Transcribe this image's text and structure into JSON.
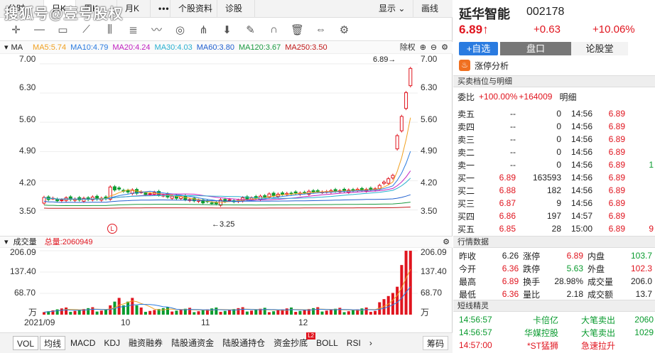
{
  "watermark": "搜狐号@壹号股权",
  "tabs": [
    "分时",
    "日K",
    "周K",
    "月K",
    "•••",
    "个股资料",
    "诊股"
  ],
  "tabs_right": {
    "display": "显示",
    "draw": "画线"
  },
  "toolbar_icons": [
    "crosshair-icon",
    "line-icon",
    "rect-icon",
    "fan-icon",
    "gann-icon",
    "fib-icon",
    "wave-icon",
    "cycle-icon",
    "pitchfork-icon",
    "arrow-down-icon",
    "eraser-icon",
    "magnet-icon",
    "trash-icon",
    "expand-icon",
    "settings-icon"
  ],
  "ma_bar": {
    "label": "MA",
    "items": [
      {
        "text": "MA5:5.74",
        "color": "#f0a020"
      },
      {
        "text": "MA10:4.79",
        "color": "#2a7be0"
      },
      {
        "text": "MA20:4.24",
        "color": "#c020c0"
      },
      {
        "text": "MA30:4.03",
        "color": "#28b0d0"
      },
      {
        "text": "MA60:3.80",
        "color": "#2060d0"
      },
      {
        "text": "MA120:3.67",
        "color": "#1a9a40"
      },
      {
        "text": "MA250:3.50",
        "color": "#c01818"
      }
    ],
    "right_label": "除权"
  },
  "price_axis": [
    "7.00",
    "6.30",
    "5.60",
    "4.90",
    "4.20",
    "3.50"
  ],
  "annotations": {
    "high": "6.89→",
    "low": "←3.25",
    "marker": "L"
  },
  "volume_bar": {
    "label": "成交量",
    "total": "总量:2060949"
  },
  "volume_axis": [
    "206.09",
    "137.40",
    "68.70",
    "万"
  ],
  "x_labels": [
    "2021/09",
    "10",
    "11",
    "12"
  ],
  "bottom_tabs": [
    "VOL",
    "均线",
    "MACD",
    "KDJ",
    "融资融券",
    "陆股通资金",
    "陆股通持仓",
    "资金抄底",
    "BOLL",
    "RSI",
    "›"
  ],
  "bottom_badge": "L2",
  "bottom_right": "筹码",
  "stock": {
    "name": "延华智能",
    "code": "002178",
    "price": "6.89",
    "arrow": "↑",
    "change": "+0.63",
    "pct": "+10.06%"
  },
  "buttons": {
    "add": "+自选",
    "panel": "盘口",
    "forum": "论股堂"
  },
  "limit_label": "涨停分析",
  "orderbook": {
    "title": "买卖档位与明细",
    "ratio_label": "委比",
    "ratio_value": "+100.00%",
    "ratio_diff": "+164009",
    "detail_label": "明细",
    "sells": [
      {
        "name": "卖五",
        "price": "--",
        "vol": "0"
      },
      {
        "name": "卖四",
        "price": "--",
        "vol": "0"
      },
      {
        "name": "卖三",
        "price": "--",
        "vol": "0"
      },
      {
        "name": "卖二",
        "price": "--",
        "vol": "0"
      },
      {
        "name": "卖一",
        "price": "--",
        "vol": "0"
      }
    ],
    "buys": [
      {
        "name": "买一",
        "price": "6.89",
        "vol": "163593"
      },
      {
        "name": "买二",
        "price": "6.88",
        "vol": "182"
      },
      {
        "name": "买三",
        "price": "6.87",
        "vol": "9"
      },
      {
        "name": "买四",
        "price": "6.86",
        "vol": "197"
      },
      {
        "name": "买五",
        "price": "6.85",
        "vol": "28"
      }
    ],
    "ticks": [
      {
        "t": "14:56",
        "p": "6.89",
        "v": "",
        "c": "red"
      },
      {
        "t": "14:56",
        "p": "6.89",
        "v": "",
        "c": "red"
      },
      {
        "t": "14:56",
        "p": "6.89",
        "v": "",
        "c": "red"
      },
      {
        "t": "14:56",
        "p": "6.89",
        "v": "",
        "c": "red"
      },
      {
        "t": "14:56",
        "p": "6.89",
        "v": "1",
        "c": "green"
      },
      {
        "t": "14:56",
        "p": "6.89",
        "v": "",
        "c": "red"
      },
      {
        "t": "14:56",
        "p": "6.89",
        "v": "",
        "c": "red"
      },
      {
        "t": "14:56",
        "p": "6.89",
        "v": "",
        "c": "red"
      },
      {
        "t": "14:57",
        "p": "6.89",
        "v": "",
        "c": "red"
      },
      {
        "t": "15:00",
        "p": "6.89",
        "v": "9",
        "c": "red"
      }
    ]
  },
  "quote": {
    "title": "行情数据",
    "rows": [
      [
        {
          "l": "昨收",
          "v": "6.26",
          "c": ""
        },
        {
          "l": "涨停",
          "v": "6.89",
          "c": "red"
        },
        {
          "l": "内盘",
          "v": "103.7",
          "c": "green"
        }
      ],
      [
        {
          "l": "今开",
          "v": "6.36",
          "c": "red"
        },
        {
          "l": "跌停",
          "v": "5.63",
          "c": "green"
        },
        {
          "l": "外盘",
          "v": "102.3",
          "c": "red"
        }
      ],
      [
        {
          "l": "最高",
          "v": "6.89",
          "c": "red"
        },
        {
          "l": "换手",
          "v": "28.98%",
          "c": ""
        },
        {
          "l": "成交量",
          "v": "206.0",
          "c": ""
        }
      ],
      [
        {
          "l": "最低",
          "v": "6.36",
          "c": "red"
        },
        {
          "l": "量比",
          "v": "2.18",
          "c": ""
        },
        {
          "l": "成交额",
          "v": "13.7",
          "c": ""
        }
      ]
    ]
  },
  "sprite": {
    "title": "短线精灵",
    "rows": [
      {
        "t": "14:56:57",
        "name": "卡倍亿",
        "type": "大笔卖出",
        "val": "2060",
        "c": "green"
      },
      {
        "t": "14:56:57",
        "name": "华媒控股",
        "type": "大笔卖出",
        "val": "1029",
        "c": "green"
      },
      {
        "t": "14:57:00",
        "name": "*ST猛狮",
        "type": "急速拉升",
        "val": "",
        "c": "red"
      }
    ]
  },
  "chart_data": {
    "type": "candlestick",
    "ylim": [
      3.0,
      7.1
    ],
    "annotations": [
      "6.89",
      "3.25"
    ],
    "close_last_days": [
      5.28,
      5.74,
      6.31,
      6.89
    ],
    "volume_ylim": [
      0,
      206.09
    ]
  }
}
